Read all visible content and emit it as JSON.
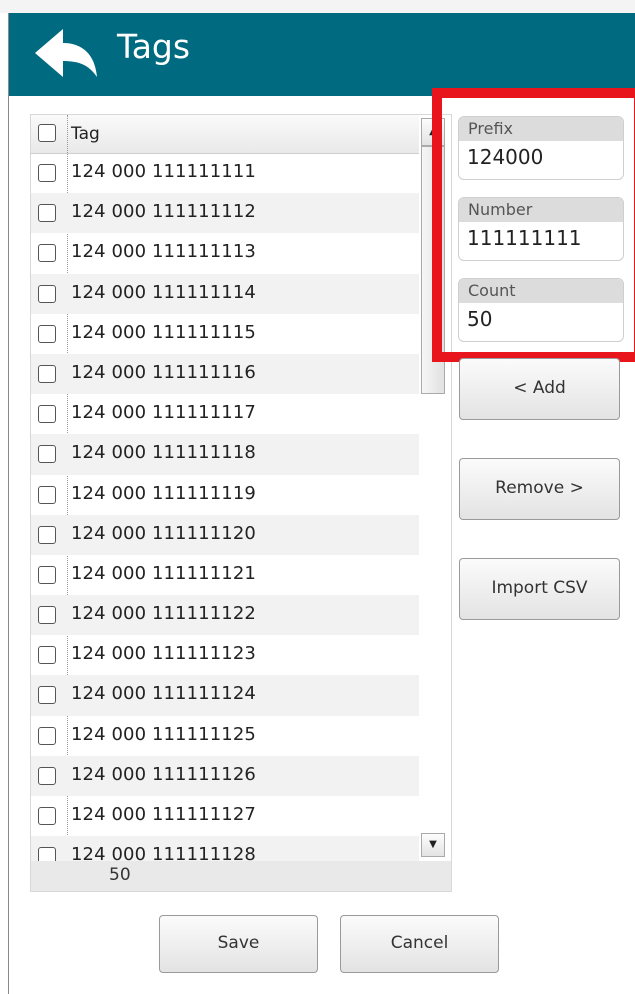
{
  "header": {
    "title": "Tags",
    "back_icon": "back-arrow-icon"
  },
  "list": {
    "column_header": "Tag",
    "rows": [
      "124 000 111111111",
      "124 000 111111112",
      "124 000 111111113",
      "124 000 111111114",
      "124 000 111111115",
      "124 000 111111116",
      "124 000 111111117",
      "124 000 111111118",
      "124 000 111111119",
      "124 000 111111120",
      "124 000 111111121",
      "124 000 111111122",
      "124 000 111111123",
      "124 000 111111124",
      "124 000 111111125",
      "124 000 111111126",
      "124 000 111111127",
      "124 000 111111128"
    ],
    "footer_count": "50"
  },
  "fields": {
    "prefix": {
      "label": "Prefix",
      "value": "124000"
    },
    "number": {
      "label": "Number",
      "value": "111111111"
    },
    "count": {
      "label": "Count",
      "value": "50"
    }
  },
  "buttons": {
    "add": "< Add",
    "remove": "Remove >",
    "import_csv": "Import CSV",
    "save": "Save",
    "cancel": "Cancel"
  },
  "colors": {
    "header": "#006a80",
    "highlight": "#e8151d"
  }
}
